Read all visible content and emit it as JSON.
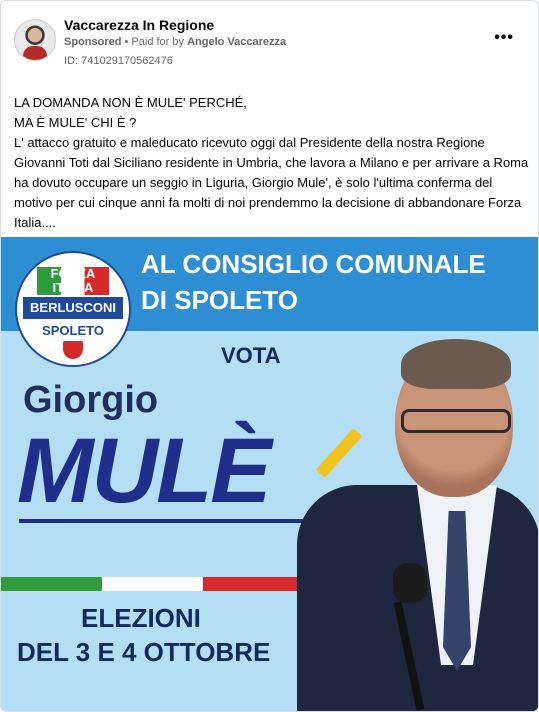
{
  "post": {
    "page_name": "Vaccarezza In Regione",
    "sponsored": "Sponsored",
    "separator": " • ",
    "paid_prefix": "Paid for by ",
    "paid_by": "Angelo Vaccarezza",
    "ad_id": "ID: 741029170562476",
    "more_icon": "more-options-icon",
    "more_label": "•••",
    "text_lines": [
      "LA DOMANDA NON È MULE' PERCHÉ,",
      "MA È MULE' CHI È ?",
      "L' attacco gratuito e maleducato ricevuto oggi dal Presidente della nostra Regione Giovanni Toti dal Siciliano residente in Umbria, che lavora a Milano e per arrivare a Roma ha dovuto occupare un seggio in Liguria, Giorgio Mule', è solo l'ultima conferma del motivo per cui cinque anni fa molti di noi prendemmo la decisione di abbandonare Forza Italia...."
    ]
  },
  "banner": {
    "headline1": "AL CONSIGLIO COMUNALE",
    "headline2": "DI SPOLETO",
    "vota": "VOTA",
    "first_name": "Giorgio",
    "last_name": "MULÈ",
    "elections1": "ELEZIONI",
    "elections2": "DEL 3 E 4 OTTOBRE",
    "logo": {
      "top": "FORZA ITALIA",
      "middle": "BERLUSCONI",
      "bottom": "SPOLETO"
    },
    "colors": {
      "blue_band": "#2e8ed3",
      "background": "#b3def4",
      "navy": "#1f2e8a",
      "green": "#2f9b3a",
      "red": "#d62a2a"
    }
  }
}
